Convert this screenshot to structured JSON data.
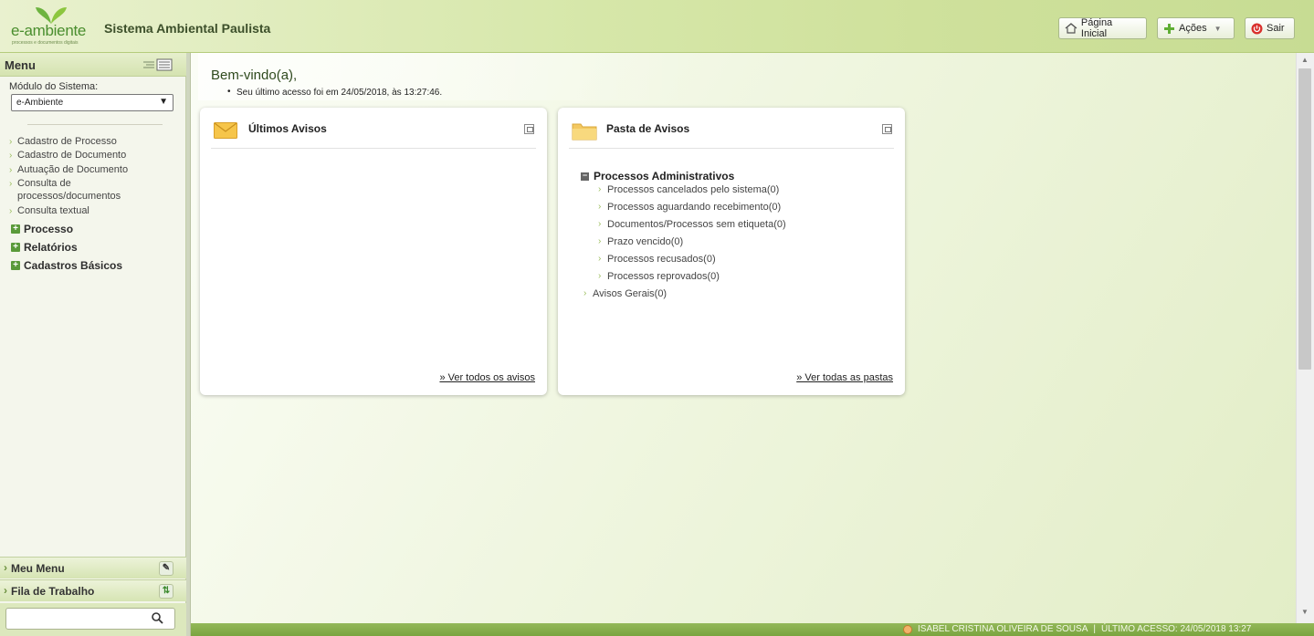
{
  "header": {
    "logo_brand": "e-ambiente",
    "logo_tagline": "processos e documentos digitais",
    "system_title": "Sistema Ambiental Paulista",
    "home_label": "Página Inicial",
    "acoes_label": "Ações",
    "sair_label": "Sair"
  },
  "sidebar": {
    "menu_label": "Menu",
    "module_label": "Módulo do Sistema:",
    "module_selected": "e-Ambiente",
    "items": [
      {
        "label": "Cadastro de Processo"
      },
      {
        "label": "Cadastro de Documento"
      },
      {
        "label": "Autuação de Documento"
      },
      {
        "label": "Consulta de"
      },
      {
        "label": "processos/documentos"
      },
      {
        "label": "Consulta textual"
      }
    ],
    "groups": [
      {
        "label": "Processo"
      },
      {
        "label": "Relatórios"
      },
      {
        "label": "Cadastros Básicos"
      }
    ],
    "meu_menu": "Meu Menu",
    "fila_trabalho": "Fila de Trabalho",
    "search_placeholder": ""
  },
  "main": {
    "welcome": "Bem-vindo(a),",
    "last_access": "Seu último acesso foi em 24/05/2018, às 13:27:46.",
    "panel_avisos": {
      "title": "Últimos Avisos",
      "link": "» Ver todos os avisos"
    },
    "panel_pasta": {
      "title": "Pasta de Avisos",
      "group": "Processos Administrativos",
      "items": [
        {
          "label": "Processos cancelados pelo sistema(0)"
        },
        {
          "label": "Processos aguardando recebimento(0)"
        },
        {
          "label": "Documentos/Processos sem etiqueta(0)"
        },
        {
          "label": "Prazo vencido(0)"
        },
        {
          "label": "Processos recusados(0)"
        },
        {
          "label": "Processos reprovados(0)"
        }
      ],
      "avisos_gerais": "Avisos Gerais(0)",
      "link": "» Ver todas as pastas"
    }
  },
  "footer": {
    "user": "ISABEL CRISTINA OLIVEIRA DE SOUSA",
    "separator": "|",
    "last_access": "ÚLTIMO ACESSO: 24/05/2018 13:27"
  },
  "colors": {
    "brand_green": "#4a8e2e",
    "header_bg": "#d6e7a9",
    "footer_bg": "#7aa43f"
  },
  "icons": [
    "leaf-logo-icon",
    "home-icon",
    "plus-icon",
    "power-icon",
    "list-toggle-icon",
    "mail-icon",
    "folder-icon",
    "wrench-icon",
    "refresh-icon",
    "search-icon",
    "user-icon"
  ]
}
